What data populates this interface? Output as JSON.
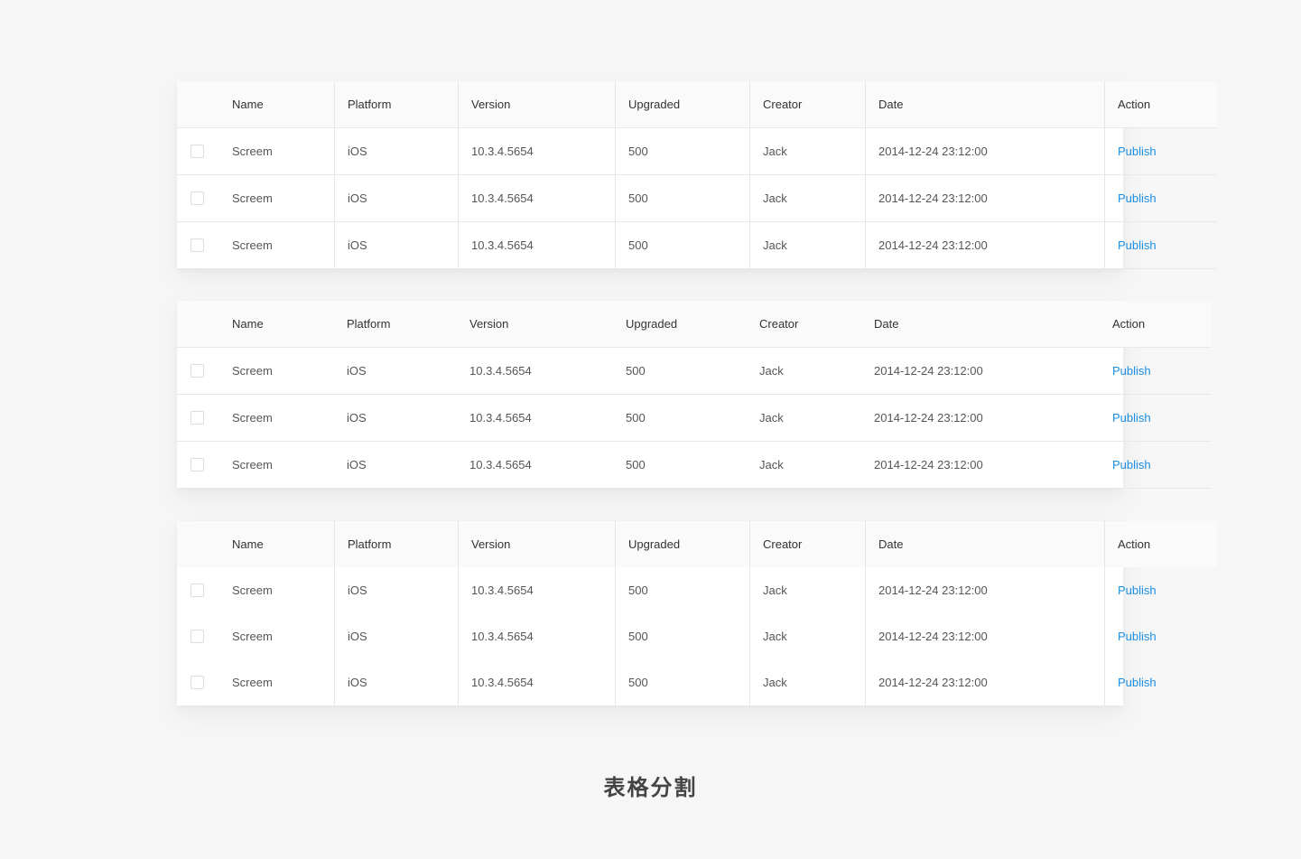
{
  "columns": {
    "name": "Name",
    "platform": "Platform",
    "version": "Version",
    "upgraded": "Upgraded",
    "creator": "Creator",
    "date": "Date",
    "action": "Action"
  },
  "tables": [
    {
      "style": "full-grid",
      "rows": [
        {
          "name": "Screem",
          "platform": "iOS",
          "version": "10.3.4.5654",
          "upgraded": "500",
          "creator": "Jack",
          "date": "2014-12-24 23:12:00",
          "action": "Publish"
        },
        {
          "name": "Screem",
          "platform": "iOS",
          "version": "10.3.4.5654",
          "upgraded": "500",
          "creator": "Jack",
          "date": "2014-12-24 23:12:00",
          "action": "Publish"
        },
        {
          "name": "Screem",
          "platform": "iOS",
          "version": "10.3.4.5654",
          "upgraded": "500",
          "creator": "Jack",
          "date": "2014-12-24 23:12:00",
          "action": "Publish"
        }
      ]
    },
    {
      "style": "horizontal-lines",
      "rows": [
        {
          "name": "Screem",
          "platform": "iOS",
          "version": "10.3.4.5654",
          "upgraded": "500",
          "creator": "Jack",
          "date": "2014-12-24 23:12:00",
          "action": "Publish"
        },
        {
          "name": "Screem",
          "platform": "iOS",
          "version": "10.3.4.5654",
          "upgraded": "500",
          "creator": "Jack",
          "date": "2014-12-24 23:12:00",
          "action": "Publish"
        },
        {
          "name": "Screem",
          "platform": "iOS",
          "version": "10.3.4.5654",
          "upgraded": "500",
          "creator": "Jack",
          "date": "2014-12-24 23:12:00",
          "action": "Publish"
        }
      ]
    },
    {
      "style": "vertical-lines",
      "rows": [
        {
          "name": "Screem",
          "platform": "iOS",
          "version": "10.3.4.5654",
          "upgraded": "500",
          "creator": "Jack",
          "date": "2014-12-24 23:12:00",
          "action": "Publish"
        },
        {
          "name": "Screem",
          "platform": "iOS",
          "version": "10.3.4.5654",
          "upgraded": "500",
          "creator": "Jack",
          "date": "2014-12-24 23:12:00",
          "action": "Publish"
        },
        {
          "name": "Screem",
          "platform": "iOS",
          "version": "10.3.4.5654",
          "upgraded": "500",
          "creator": "Jack",
          "date": "2014-12-24 23:12:00",
          "action": "Publish"
        }
      ]
    }
  ],
  "caption": "表格分割",
  "colors": {
    "background": "#f6f6f6",
    "header_background": "#fafafa",
    "link": "#1a8fe3",
    "divider": "#e6e6e6"
  }
}
